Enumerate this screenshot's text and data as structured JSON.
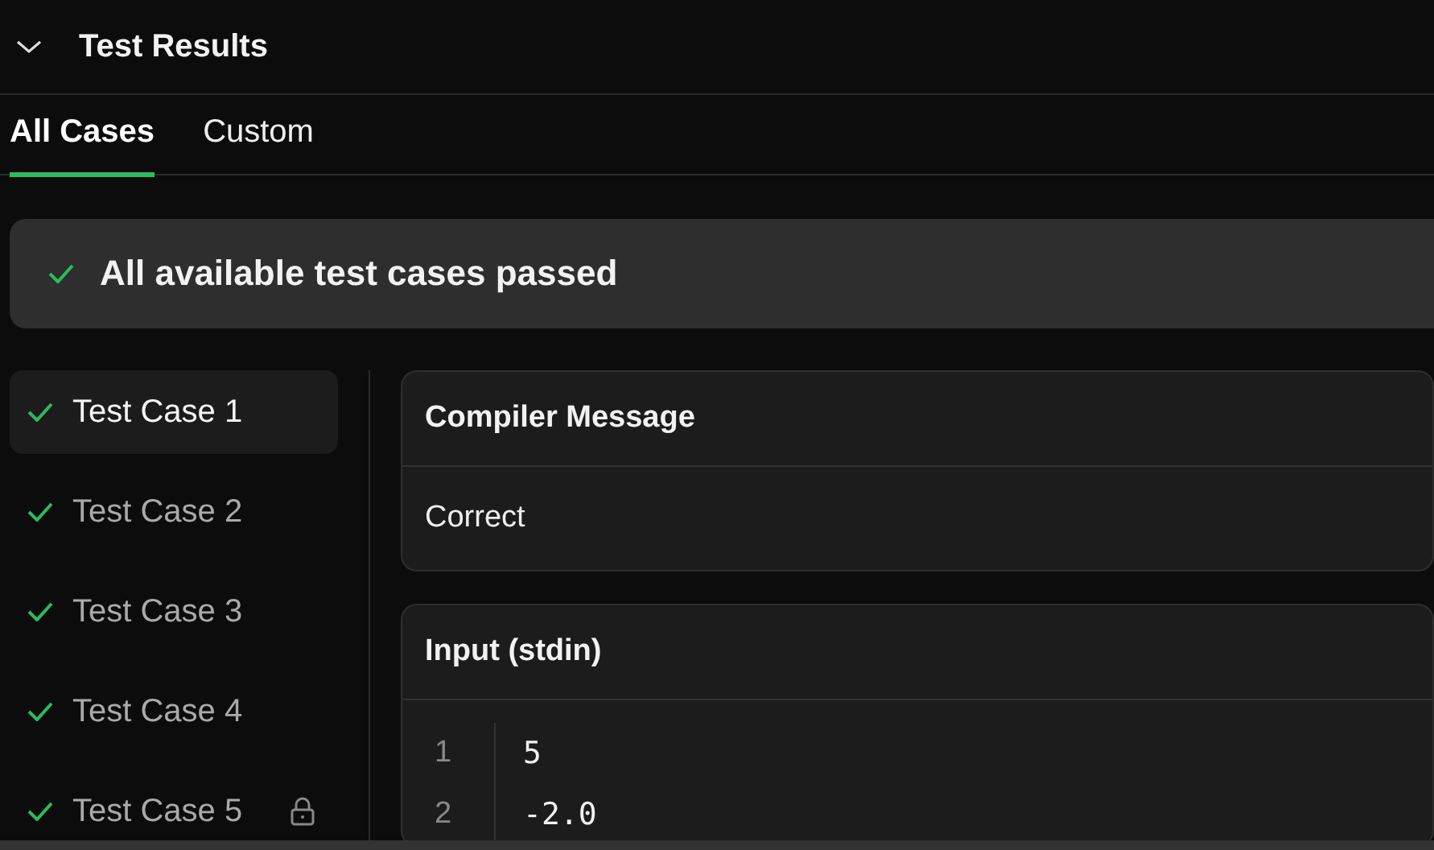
{
  "panel": {
    "title": "Test Results",
    "expanded": true
  },
  "tabs": [
    {
      "label": "All Cases",
      "selected": true
    },
    {
      "label": "Custom",
      "selected": false
    }
  ],
  "banner": {
    "text": "All available test cases passed",
    "passed": true
  },
  "cases": [
    {
      "label": "Test Case 1",
      "passed": true,
      "selected": true,
      "locked": false
    },
    {
      "label": "Test Case 2",
      "passed": true,
      "selected": false,
      "locked": false
    },
    {
      "label": "Test Case 3",
      "passed": true,
      "selected": false,
      "locked": false
    },
    {
      "label": "Test Case 4",
      "passed": true,
      "selected": false,
      "locked": false
    },
    {
      "label": "Test Case 5",
      "passed": true,
      "selected": false,
      "locked": true
    }
  ],
  "sections": [
    {
      "title": "Compiler Message",
      "kind": "text",
      "text": "Correct"
    },
    {
      "title": "Input (stdin)",
      "kind": "code",
      "lines": [
        {
          "number": "1",
          "code": "5"
        },
        {
          "number": "2",
          "code": "-2.0"
        }
      ]
    }
  ]
}
